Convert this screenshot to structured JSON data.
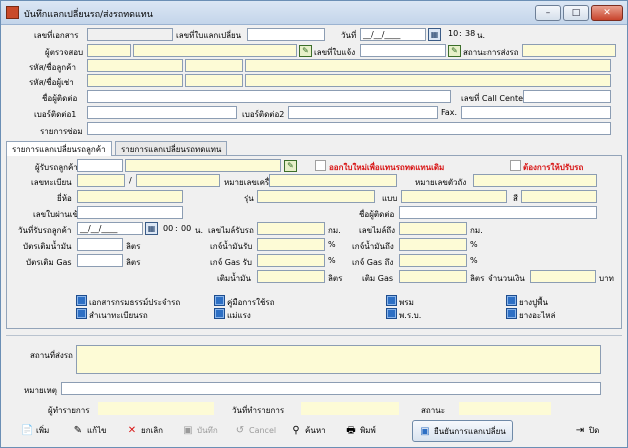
{
  "window": {
    "title": "บันทึกแลกเปลี่ยนรถ/ส่งรถทดแทน",
    "btn_min": "–",
    "btn_max": "□",
    "btn_close": "✕"
  },
  "header": {
    "doc_no_label": "เลขที่เอกสาร",
    "receipt_no_label": "เลขที่ใบแลกเปลี่ยน",
    "date_label": "วันที่",
    "date_value": "__/__/____",
    "time_hour": "10",
    "time_sep": ":",
    "time_min": "38",
    "time_suffix": "น.",
    "inspector_label": "ผู้ตรวจสอบ",
    "notify_no_label": "เลขที่ใบแจ้ง",
    "status_label": "สถานะการส่งรถ",
    "customer_code_label": "รหัส/ชื่อลูกค้า",
    "renter_code_label": "รหัส/ชื่อผู้เช่า",
    "contact_name_label": "ชื่อผู้ติดต่อ",
    "call_center_label": "เลขที่ Call Center",
    "phone1_label": "เบอร์ติดต่อ1",
    "phone2_label": "เบอร์ติดต่อ2",
    "fax_label": "Fax.",
    "repair_list_label": "รายการซ่อม"
  },
  "tabs": [
    {
      "label": "รายการแลกเปลี่ยนรถลูกค้า"
    },
    {
      "label": "รายการแลกเปลี่ยนรถทดแทน"
    }
  ],
  "panel": {
    "car_receiver_label": "ผู้รับรถลูกค้า",
    "new_issue_label": "ออกใบใหม่เพื่อแทนรถทดแทนเดิม",
    "need_repair_label": "ต้องการให้ปรับรถ",
    "plate_label": "เลขทะเบียน",
    "plate_sep": "/",
    "engine_no_label": "หมายเลขเครื่อง",
    "chassis_no_label": "หมายเลขตัวถัง",
    "brand_label": "ยี่ห้อ",
    "model_label": "รุ่น",
    "type_label": "แบบ",
    "color_label": "สี",
    "inbound_no_label": "เลขใบผ่านเข้า",
    "contact_name_label": "ชื่อผู้ติดต่อ",
    "receive_date_label": "วันที่รับรถลูกค้า",
    "receive_date_value": "__/__/____",
    "receive_time_hour": "00",
    "receive_time_sep": ":",
    "receive_time_min": "00",
    "receive_time_suffix": "น.",
    "mileage_recv_label": "เลขไมล์รับรถ",
    "km1": "กม.",
    "mileage_out_label": "เลขไมล์ถึง",
    "km2": "กม.",
    "fuel_card_label": "บัตรเติมน้ำมัน",
    "liter1": "ลิตร",
    "fuel_recv_label": "เกจ์น้ำมันรับ",
    "pct1": "%",
    "fuel_to_label": "เกจ์น้ำมันถึง",
    "pct2": "%",
    "gas_card_label": "บัตรเติม Gas",
    "liter2": "ลิตร",
    "gas_recv_label": "เกจ์ Gas รับ",
    "pct3": "%",
    "gas_to_label": "เกจ์ Gas ถึง",
    "pct4": "%",
    "oil_fill_label": "เติมน้ำมัน",
    "liter3": "ลิตร",
    "gas_fill_label": "เติม Gas",
    "liter4": "ลิตร",
    "amount_label": "จำนวนเงิน",
    "baht": "บาท",
    "checks": [
      {
        "label": "เอกสารกรมธรรม์ประจำรถ"
      },
      {
        "label": "คู่มือการใช้รถ"
      },
      {
        "label": "พรม"
      },
      {
        "label": "ยางปูพื้น"
      },
      {
        "label": "สำเนาทะเบียนรถ"
      },
      {
        "label": "แม่แรง"
      },
      {
        "label": "พ.ร.บ."
      },
      {
        "label": "ยางอะไหล่"
      }
    ]
  },
  "footer": {
    "delivery_place_label": "สถานที่ส่งรถ",
    "remark_label": "หมายเหตุ",
    "recorder_label": "ผู้ทำรายการ",
    "record_date_label": "วันที่ทำรายการ",
    "state_label": "สถานะ"
  },
  "toolbar": {
    "add": "เพิ่ม",
    "edit": "แก้ไข",
    "cancel_doc": "ยกเลิก",
    "save": "บันทึก",
    "cancel": "Cancel",
    "search": "ค้นหา",
    "print": "พิมพ์",
    "confirm": "ยืนยันการแลกเปลี่ยน",
    "close": "ปิด"
  }
}
